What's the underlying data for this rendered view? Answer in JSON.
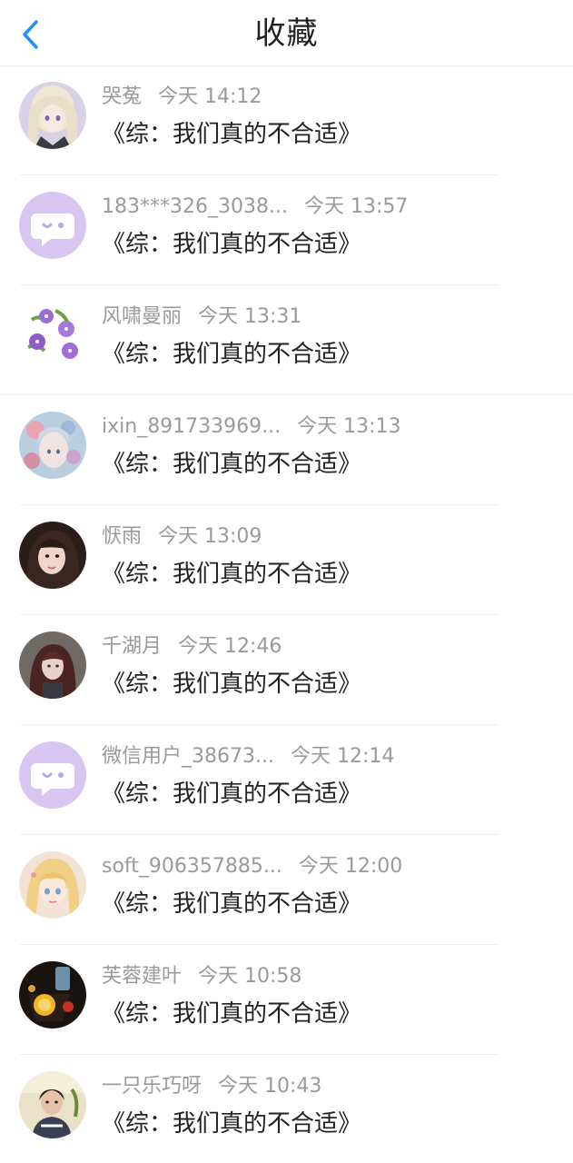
{
  "header": {
    "title": "收藏",
    "back_icon": "chevron-left-icon",
    "accent_color": "#1e90ff"
  },
  "items": [
    {
      "name": "哭菟",
      "time": "今天 14:12",
      "content": "《综：我们真的不合适》",
      "avatar": "anime-girl-avatar"
    },
    {
      "name": "183***326_3038...",
      "time": "今天 13:57",
      "content": "《综：我们真的不合适》",
      "avatar": "default-chat-avatar"
    },
    {
      "name": "风啸曼丽",
      "time": "今天 13:31",
      "content": "《综：我们真的不合适》",
      "avatar": "purple-flowers-avatar"
    },
    {
      "name": "ixin_891733969...",
      "time": "今天 13:13",
      "content": "《综：我们真的不合适》",
      "avatar": "floral-illustration-avatar"
    },
    {
      "name": "恹雨",
      "time": "今天 13:09",
      "content": "《综：我们真的不合适》",
      "avatar": "girl-photo-avatar"
    },
    {
      "name": "千湖月",
      "time": "今天 12:46",
      "content": "《综：我们真的不合适》",
      "avatar": "dark-hair-illustration-avatar"
    },
    {
      "name": "微信用户_38673...",
      "time": "今天 12:14",
      "content": "《综：我们真的不合适》",
      "avatar": "default-chat-avatar"
    },
    {
      "name": "soft_906357885...",
      "time": "今天 12:00",
      "content": "《综：我们真的不合适》",
      "avatar": "blonde-anime-avatar"
    },
    {
      "name": "芙蓉建叶",
      "time": "今天 10:58",
      "content": "《综：我们真的不合适》",
      "avatar": "drink-photo-avatar"
    },
    {
      "name": "一只乐巧呀",
      "time": "今天 10:43",
      "content": "《综：我们真的不合适》",
      "avatar": "woman-photo-avatar"
    }
  ]
}
